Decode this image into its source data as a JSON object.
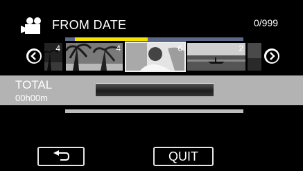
{
  "header": {
    "mode_icon": "movie-camera-icon",
    "title": "FROM DATE",
    "counter": "0/999"
  },
  "progress": {
    "fraction": 0.41
  },
  "carousel": {
    "prev_icon": "chevron-left-icon",
    "next_icon": "chevron-right-icon",
    "thumbnails": [
      {
        "label": "4"
      },
      {
        "label": "4"
      },
      {
        "label": "6"
      },
      {
        "label": "2"
      }
    ]
  },
  "total": {
    "label": "TOTAL",
    "time": "00h00m"
  },
  "buttons": {
    "back_icon": "return-icon",
    "quit_label": "QUIT"
  },
  "colors": {
    "background": "#000000",
    "progress_fill": "#f2e400",
    "progress_track": "#5d6888",
    "total_bar": "#b3b3b3"
  }
}
